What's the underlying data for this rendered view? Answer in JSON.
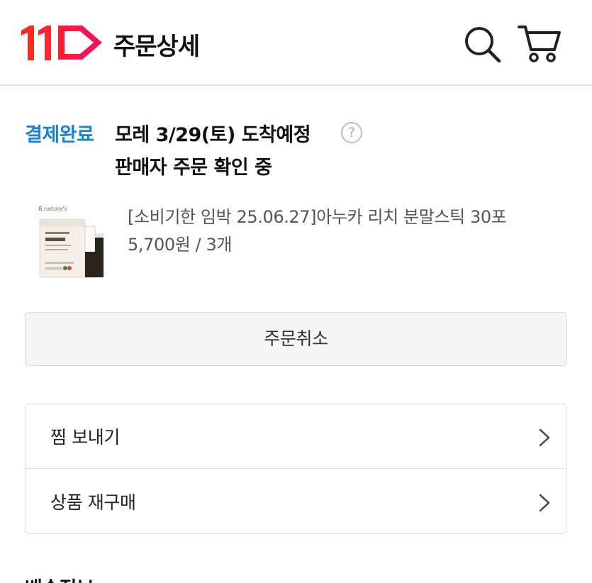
{
  "header": {
    "title": "주문상세",
    "logo_icon": "11st-logo-icon",
    "search_icon": "search-icon",
    "cart_icon": "cart-icon",
    "brand_color": "#ff0038"
  },
  "order": {
    "status_label": "결제완료",
    "status_color": "#1a82d7",
    "delivery_text": "모레 3/29(토) 도착예정",
    "help_symbol": "?",
    "seller_status": "판매자 주문 확인 중"
  },
  "product": {
    "name": "[소비기한 임박 25.06.27]아누카 리치 분말스틱 30포",
    "price_qty": "5,700원 / 3개",
    "thumb_brand": "B.nature's"
  },
  "actions": {
    "cancel_label": "주문취소",
    "wishlist_label": "찜 보내기",
    "rebuy_label": "상품 재구매"
  },
  "section": {
    "heading": "배송정보"
  }
}
